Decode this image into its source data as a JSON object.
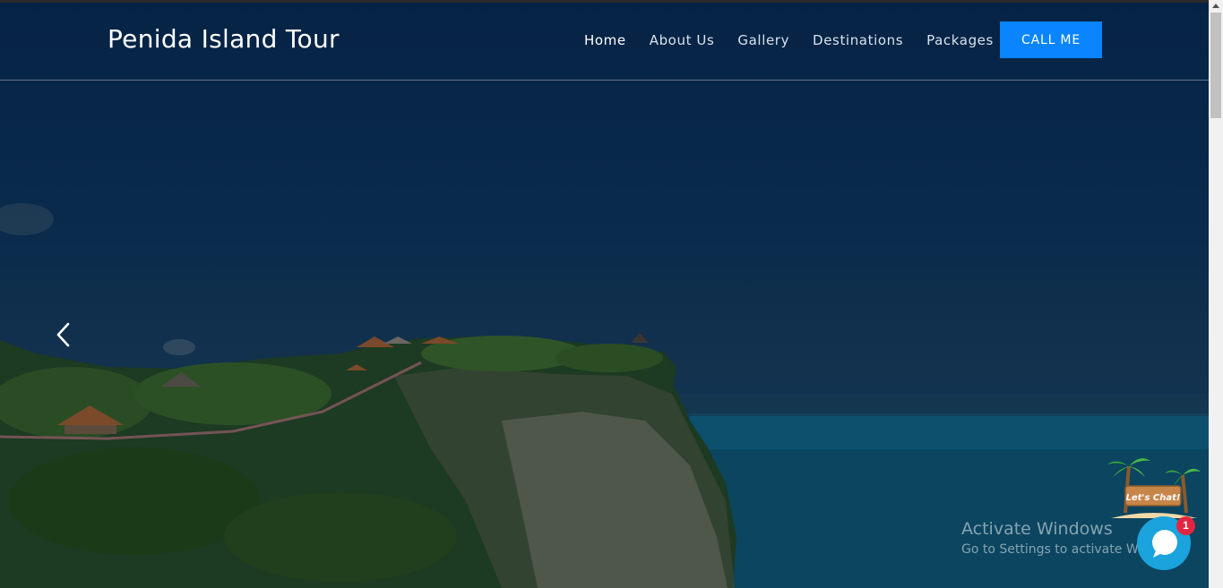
{
  "brand": "Penida Island Tour",
  "nav": {
    "items": [
      "Home",
      "About Us",
      "Gallery",
      "Destinations",
      "Packages"
    ],
    "active": "Home",
    "cta_label": "CALL ME"
  },
  "hero": {
    "prev_icon": "chevron-left-icon"
  },
  "chat": {
    "sign_text": "Let's Chat!",
    "badge_count": "1",
    "icon": "chat-bubble-icon"
  },
  "watermark": {
    "title": "Activate Windows",
    "subtitle": "Go to Settings to activate Windows."
  },
  "colors": {
    "accent": "#0a84ff",
    "navbar_bg": "#062345",
    "chat": "#1aa3dc",
    "badge": "#e3263f"
  }
}
